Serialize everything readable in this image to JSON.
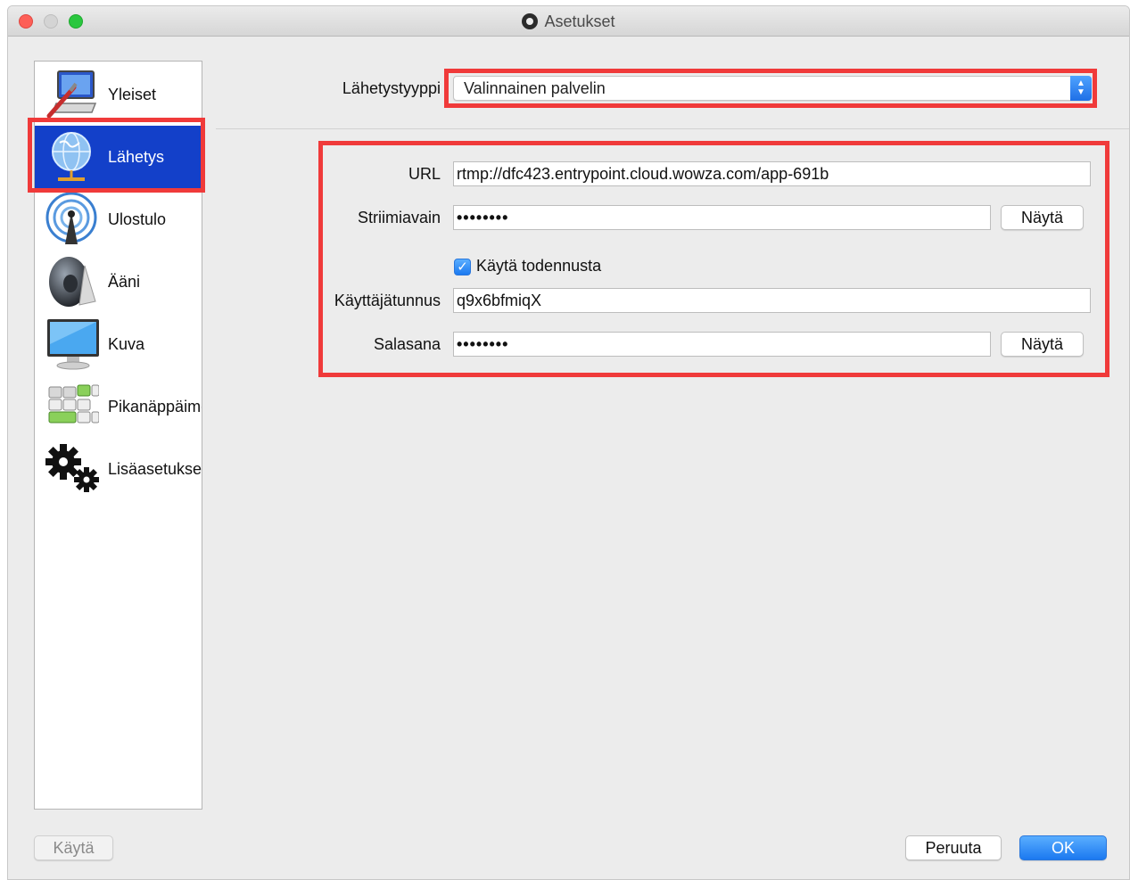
{
  "window": {
    "title": "Asetukset"
  },
  "sidebar": {
    "items": [
      {
        "label": "Yleiset",
        "icon": "general-computer-icon"
      },
      {
        "label": "Lähetys",
        "icon": "globe-network-icon",
        "active": true
      },
      {
        "label": "Ulostulo",
        "icon": "broadcast-antenna-icon"
      },
      {
        "label": "Ääni",
        "icon": "speaker-icon"
      },
      {
        "label": "Kuva",
        "icon": "monitor-icon"
      },
      {
        "label": "Pikanäppäimet",
        "icon": "keyboard-keys-icon"
      },
      {
        "label": "Lisäasetukset",
        "icon": "gears-icon"
      }
    ]
  },
  "stream": {
    "type_label": "Lähetystyyppi",
    "type_value": "Valinnainen palvelin",
    "url_label": "URL",
    "url_value": "rtmp://dfc423.entrypoint.cloud.wowza.com/app-691b",
    "key_label": "Striimiavain",
    "key_value": "••••••••",
    "show_label": "Näytä",
    "auth_label": "Käytä todennusta",
    "auth_checked": true,
    "user_label": "Käyttäjätunnus",
    "user_value": "q9x6bfmiqX",
    "pass_label": "Salasana",
    "pass_value": "••••••••"
  },
  "footer": {
    "apply": "Käytä",
    "cancel": "Peruuta",
    "ok": "OK"
  },
  "colors": {
    "selection": "#1340c9",
    "highlight": "#f03a3a",
    "accent": "#1b79f0"
  }
}
